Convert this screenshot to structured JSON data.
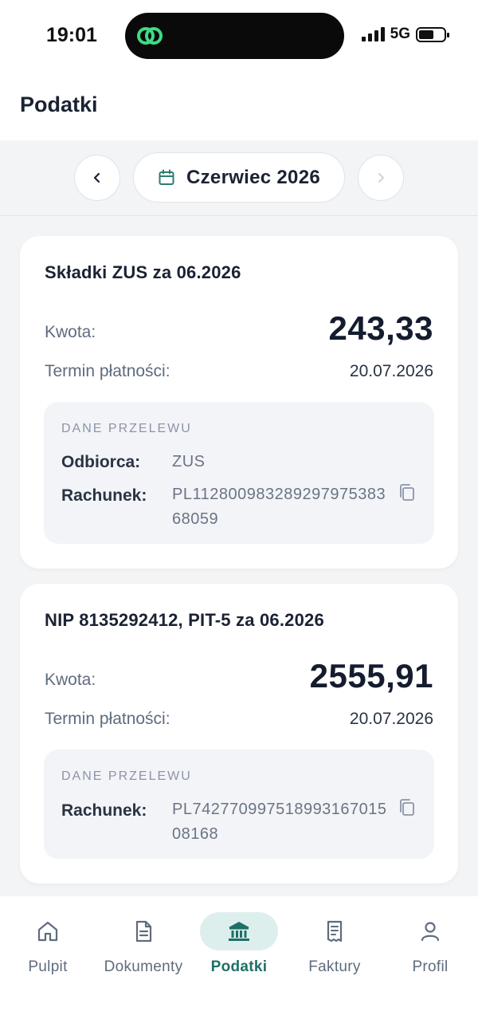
{
  "status_bar": {
    "time": "19:01",
    "network": "5G"
  },
  "header": {
    "title": "Podatki"
  },
  "month_selector": {
    "label": "Czerwiec 2026"
  },
  "cards": [
    {
      "title": "Składki ZUS za 06.2026",
      "amount_label": "Kwota:",
      "amount": "243,33",
      "due_label": "Termin płatności:",
      "due_date": "20.07.2026",
      "transfer": {
        "heading": "DANE PRZELEWU",
        "recipient_label": "Odbiorca:",
        "recipient": "ZUS",
        "account_label": "Rachunek:",
        "account": "PL11280098328929797538368059"
      }
    },
    {
      "title": "NIP 8135292412, PIT-5 za 06.2026",
      "amount_label": "Kwota:",
      "amount": "2555,91",
      "due_label": "Termin płatności:",
      "due_date": "20.07.2026",
      "transfer": {
        "heading": "DANE PRZELEWU",
        "account_label": "Rachunek:",
        "account": "PL74277099751899316701508168"
      }
    }
  ],
  "tabs": [
    {
      "label": "Pulpit",
      "icon": "home-icon"
    },
    {
      "label": "Dokumenty",
      "icon": "document-icon"
    },
    {
      "label": "Podatki",
      "icon": "bank-icon",
      "active": true
    },
    {
      "label": "Faktury",
      "icon": "receipt-icon"
    },
    {
      "label": "Profil",
      "icon": "user-icon"
    }
  ],
  "colors": {
    "accent": "#1f6f66",
    "active_tab_bg": "#dcefec",
    "island_icon": "#3ddc84"
  }
}
